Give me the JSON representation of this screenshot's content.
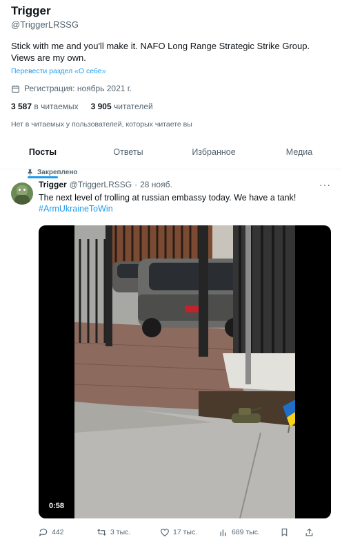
{
  "profile": {
    "name": "Trigger",
    "handle": "@TriggerLRSSG",
    "bio": "Stick with me and you'll make it. NAFO Long Range Strategic Strike Group. Views are my own.",
    "translate_link": "Перевести раздел «О себе»",
    "joined": "Регистрация: ноябрь 2021 г.",
    "following_count": "3 587",
    "following_label": "в читаемых",
    "followers_count": "3 905",
    "followers_label": "читателей",
    "no_followers_you_know": "Нет в читаемых у пользователей, которых читаете вы"
  },
  "tabs": [
    {
      "label": "Посты",
      "active": true
    },
    {
      "label": "Ответы",
      "active": false
    },
    {
      "label": "Избранное",
      "active": false
    },
    {
      "label": "Медиа",
      "active": false
    }
  ],
  "tweet": {
    "pinned_label": "Закреплено",
    "author": "Trigger",
    "handle": "@TriggerLRSSG",
    "separator": "·",
    "date": "28 нояб.",
    "more": "···",
    "text": "The next level of trolling at russian embassy today. We have a tank!",
    "hashtag": "#ArmUkraineToWin",
    "video_duration": "0:58",
    "replies": "442",
    "retweets": "3 тыс.",
    "likes": "17 тыс.",
    "views": "689 тыс."
  },
  "colors": {
    "accent": "#1d9bf0",
    "text_primary": "#0f1419",
    "text_secondary": "#536471",
    "flag_blue": "#1f6fc9",
    "flag_yellow": "#f6d21b"
  },
  "icons": {
    "calendar": "calendar-icon",
    "pin": "pin-icon",
    "reply": "reply-icon",
    "retweet": "retweet-icon",
    "like": "heart-icon",
    "views": "views-icon",
    "bookmark": "bookmark-icon",
    "share": "share-icon"
  }
}
